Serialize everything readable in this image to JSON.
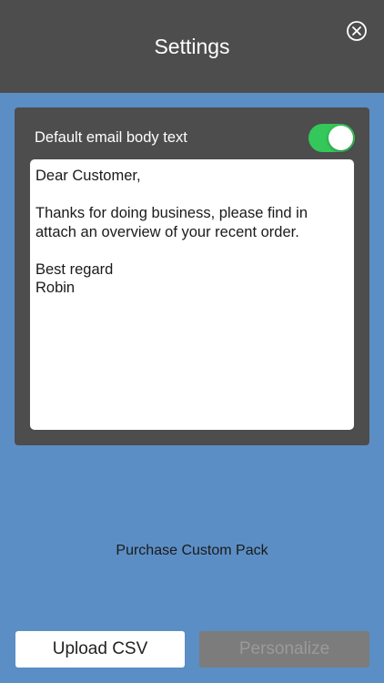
{
  "header": {
    "title": "Settings",
    "close_icon": "close-circle-icon"
  },
  "email_settings": {
    "label": "Default email body text",
    "toggle_on": true,
    "toggle_color": "#34c759",
    "body_text": "Dear Customer,\n\nThanks for doing business, please find in attach an overview of your recent order.\n\nBest regard\nRobin"
  },
  "purchase_link": "Purchase Custom Pack",
  "buttons": {
    "upload": "Upload CSV",
    "personalize": "Personalize"
  },
  "colors": {
    "background": "#5b8ec4",
    "panel": "#4d4d4d"
  }
}
